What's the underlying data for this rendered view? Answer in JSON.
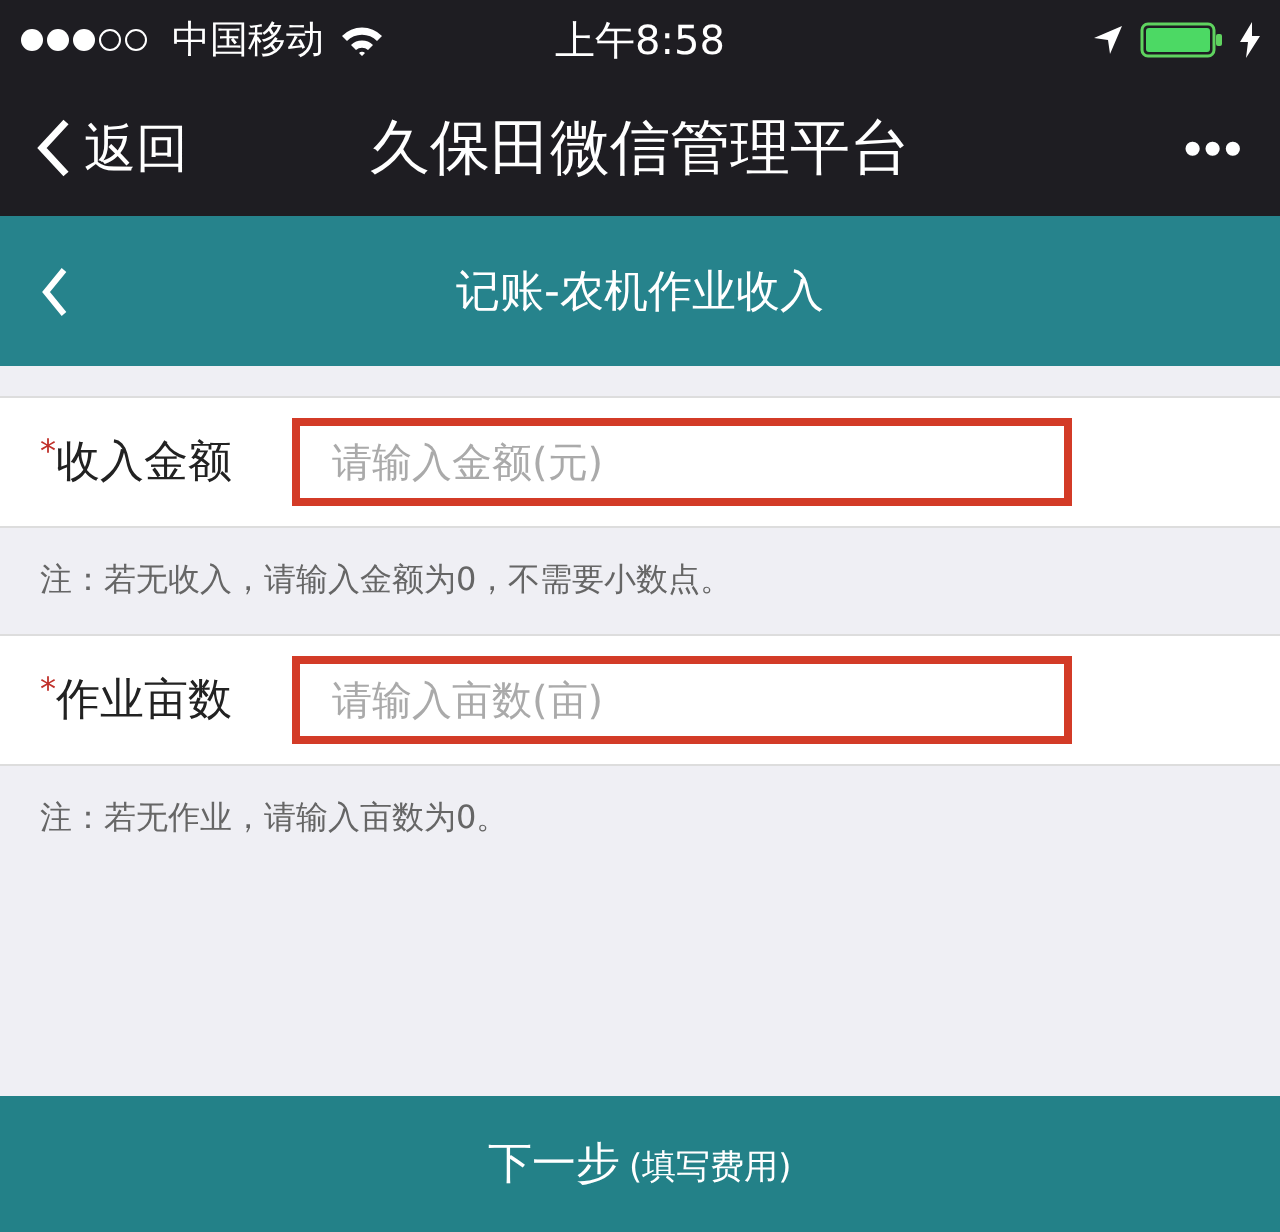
{
  "status_bar": {
    "carrier": "中国移动",
    "time": "上午8:58"
  },
  "nav_bar": {
    "back_label": "返回",
    "title": "久保田微信管理平台",
    "more": "•••"
  },
  "header": {
    "title": "记账-农机作业收入"
  },
  "fields": [
    {
      "required_mark": "*",
      "label": "收入金额",
      "placeholder": "请输入金额(元)",
      "highlighted": true,
      "note": "注：若无收入，请输入金额为0，不需要小数点。"
    },
    {
      "required_mark": "*",
      "label": "作业亩数",
      "placeholder": "请输入亩数(亩)",
      "highlighted": true,
      "note": "注：若无作业，请输入亩数为0。"
    }
  ],
  "next_button": {
    "label": "下一步",
    "hint": "(填写费用)"
  }
}
